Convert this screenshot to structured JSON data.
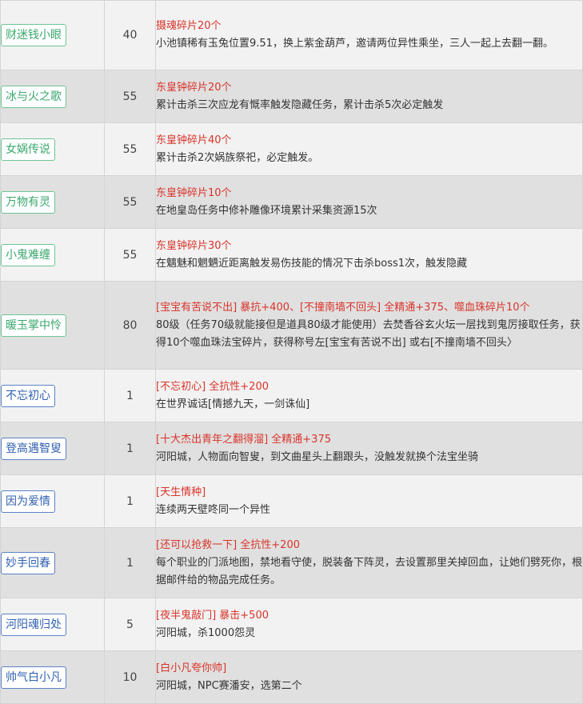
{
  "rows": [
    {
      "name": "财迷钱小眼",
      "tag_style": "green",
      "level": "40",
      "reward": "摄魂碎片20个",
      "desc": "小池镇稀有玉兔位置9.51，换上紫金葫芦，邀请两位异性乘坐，三人一起上去翻一翻。"
    },
    {
      "name": "冰与火之歌",
      "tag_style": "green",
      "level": "55",
      "reward": "东皇钟碎片20个",
      "desc": "累计击杀三次应龙有慨率触发隐藏任务，累计击杀5次必定触发"
    },
    {
      "name": "女娲传说",
      "tag_style": "green",
      "level": "55",
      "reward": "东皇钟碎片40个",
      "desc": "累计击杀2次娲族祭祀，必定触发。"
    },
    {
      "name": "万物有灵",
      "tag_style": "green",
      "level": "55",
      "reward": "东皇钟碎片10个",
      "desc": "在地皇岛任务中修补雕像环境累计采集资源15次"
    },
    {
      "name": "小鬼难缠",
      "tag_style": "green",
      "level": "55",
      "reward": "东皇钟碎片30个",
      "desc": "在魑魅和魍魉近距离触发易伤技能的情况下击杀boss1次，触发隐藏"
    },
    {
      "name": "暖玉掌中怜",
      "tag_style": "green",
      "level": "80",
      "reward": "[宝宝有苦说不出] 暴抗+400、[不撞南墙不回头] 全精通+375、噬血珠碎片10个",
      "desc": "80级（任务70级就能接但是道具80级才能使用）去焚香谷玄火坛一层找到鬼厉接取任务，获得10个噬血珠法宝碎片，获得称号左[宝宝有苦说不出] 或右[不撞南墙不回头〉"
    },
    {
      "name": "不忘初心",
      "tag_style": "blue",
      "level": "1",
      "reward": "[不忘初心] 全抗性+200",
      "desc": "在世界诚话[情撼九天，一剑诛仙]"
    },
    {
      "name": "登高遇智叟",
      "tag_style": "blue",
      "level": "1",
      "reward": "[十大杰出青年之翻得溜] 全精通+375",
      "desc": "河阳城，人物面向智叟，到文曲星头上翻跟头，没触发就换个法宝坐骑"
    },
    {
      "name": "因为爱情",
      "tag_style": "blue",
      "level": "1",
      "reward": "[天生情种]",
      "desc": "连续两天壁咚同一个异性"
    },
    {
      "name": "妙手回春",
      "tag_style": "blue",
      "level": "1",
      "reward": "[还可以抢救一下] 全抗性+200",
      "desc": "每个职业的门派地图，禁地看守使，脱装备下阵灵，去设置那里关掉回血，让她们劈死你，根据邮件给的物品完成任务。"
    },
    {
      "name": "河阳魂归处",
      "tag_style": "blue",
      "level": "5",
      "reward": "[夜半鬼敲门] 暴击+500",
      "desc": "河阳城，杀1000怨灵"
    },
    {
      "name": "帅气白小凡",
      "tag_style": "blue",
      "level": "10",
      "reward": "[白小凡夸你帅]",
      "desc": "河阳城，NPC赛潘安，选第二个"
    }
  ]
}
